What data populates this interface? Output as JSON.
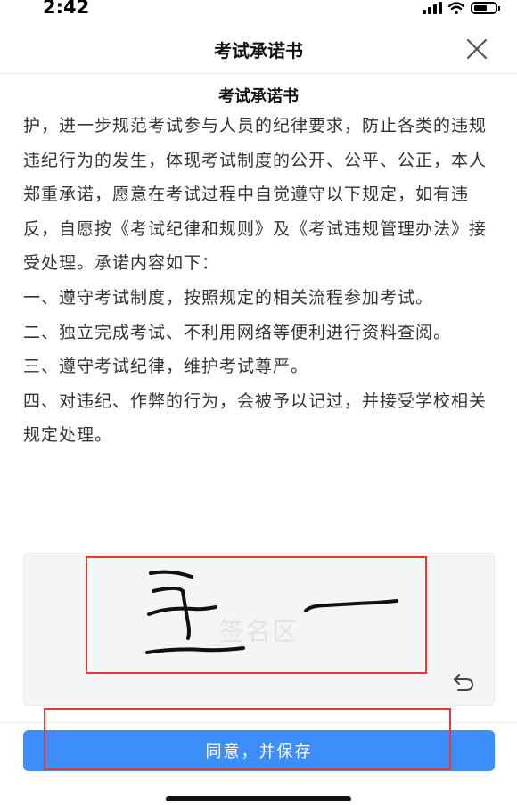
{
  "status_bar": {
    "time": "2:42",
    "icons": [
      "cellular-signal-icon",
      "wifi-icon",
      "battery-icon"
    ]
  },
  "header": {
    "title": "考试承诺书",
    "close_icon": "close-icon"
  },
  "document": {
    "title": "考试承诺书",
    "paragraphs": [
      "护，进一步规范考试参与人员的纪律要求，防止各类的违规违纪行为的发生，体现考试制度的公开、公平、公正，本人郑重承诺，愿意在考试过程中自觉遵守以下规定，如有违反，自愿按《考试纪律和规则》及《考试违规管理办法》接受处理。承诺内容如下：",
      "一、遵守考试制度，按照规定的相关流程参加考试。",
      "二、独立完成考试、不利用网络等便利进行资料查阅。",
      "三、遵守考试纪律，维护考试尊严。",
      "四、对违纪、作弊的行为，会被予以记过，并接受学校相关规定处理。"
    ]
  },
  "signature": {
    "placeholder": "签名区",
    "signed_text": "王一",
    "undo_icon": "undo-icon"
  },
  "actions": {
    "save_label": "同意，并保存"
  },
  "colors": {
    "primary": "#3d8ef8",
    "annotation": "#e03b35",
    "sign_area_bg": "#f4f5f7",
    "placeholder_text": "#e1e2e5"
  }
}
